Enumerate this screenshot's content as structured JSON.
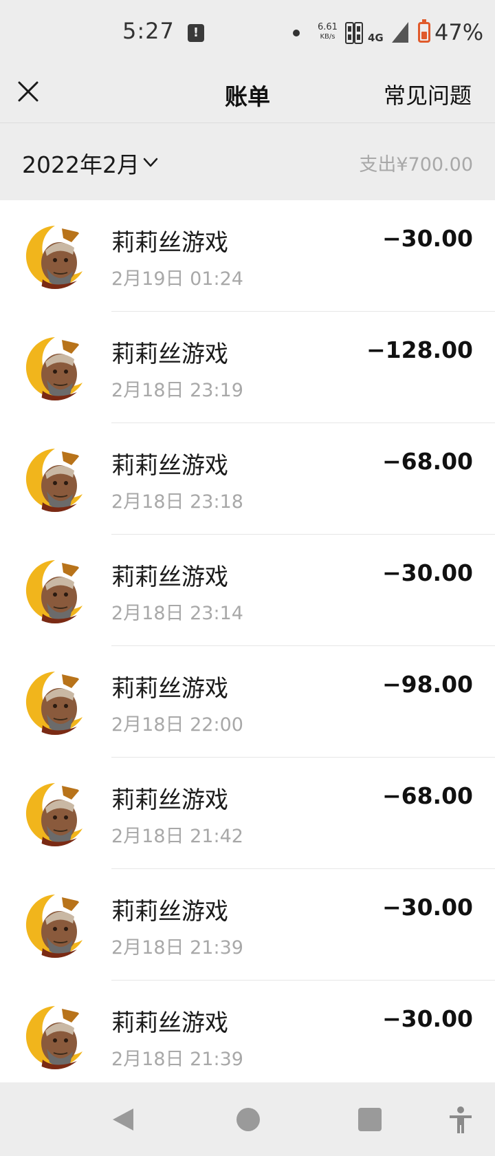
{
  "status_bar": {
    "time": "5:27",
    "notification_icon": "alert-card-icon",
    "net_speed_value": "6.61",
    "net_speed_unit": "KB/s",
    "network": "4G",
    "battery_percent": "47%",
    "battery_level": 0.47,
    "battery_color": "#e05a2b"
  },
  "nav": {
    "title": "账单",
    "faq": "常见问题",
    "close_icon": "close-icon"
  },
  "month": {
    "label": "2022年2月",
    "spend": "支出¥700.00",
    "chevron_icon": "chevron-down-icon"
  },
  "transactions": [
    {
      "merchant": "莉莉丝游戏",
      "time": "2月19日 01:24",
      "amount": "−30.00"
    },
    {
      "merchant": "莉莉丝游戏",
      "time": "2月18日 23:19",
      "amount": "−128.00"
    },
    {
      "merchant": "莉莉丝游戏",
      "time": "2月18日 23:18",
      "amount": "−68.00"
    },
    {
      "merchant": "莉莉丝游戏",
      "time": "2月18日 23:14",
      "amount": "−30.00"
    },
    {
      "merchant": "莉莉丝游戏",
      "time": "2月18日 22:00",
      "amount": "−98.00"
    },
    {
      "merchant": "莉莉丝游戏",
      "time": "2月18日 21:42",
      "amount": "−68.00"
    },
    {
      "merchant": "莉莉丝游戏",
      "time": "2月18日 21:39",
      "amount": "−30.00"
    },
    {
      "merchant": "莉莉丝游戏",
      "time": "2月18日 21:39",
      "amount": "−30.00"
    }
  ],
  "system_nav": {
    "back_icon": "back-triangle-icon",
    "home_icon": "home-circle-icon",
    "recents_icon": "recents-square-icon",
    "accessibility_icon": "accessibility-icon"
  }
}
